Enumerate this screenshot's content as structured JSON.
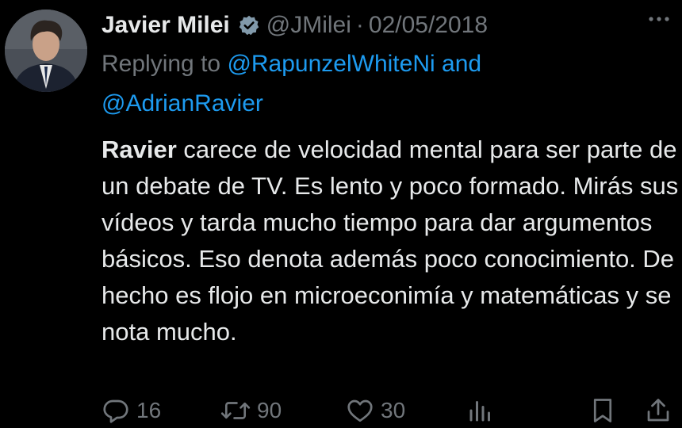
{
  "author": {
    "name": "Javier Milei",
    "handle": "@JMilei",
    "date": "02/05/2018"
  },
  "reply": {
    "prefix": "Replying to",
    "mention_1": "@RapunzelWhiteNi",
    "conjunction": "and",
    "mention_2": "@AdrianRavier"
  },
  "body": {
    "highlight": "Ravier",
    "text": " carece de velocidad mental para ser parte de un debate de TV. Es lento y poco formado. Mirás sus vídeos y tarda mucho tiempo para dar argumentos básicos. Eso denota además poco conocimiento. De hecho es flojo en microeconimía y matemáticas y se nota mucho."
  },
  "actions": {
    "replies": "16",
    "retweets": "90",
    "likes": "30"
  },
  "colors": {
    "background": "#000000",
    "text": "#e7e9ea",
    "muted": "#71767b",
    "link": "#1d9bf0",
    "verified_badge": "#829aab"
  },
  "icons": [
    "verified-icon",
    "more-icon",
    "reply-icon",
    "retweet-icon",
    "like-icon",
    "views-icon",
    "bookmark-icon",
    "share-icon"
  ]
}
